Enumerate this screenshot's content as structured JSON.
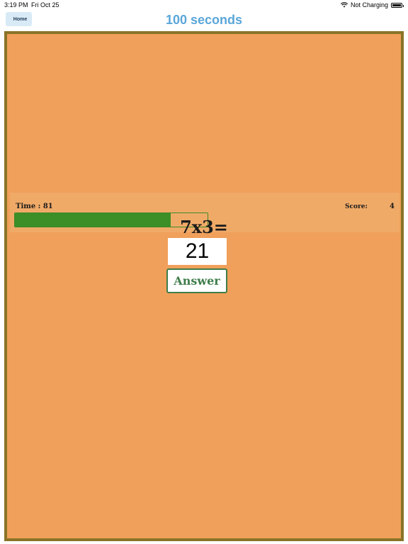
{
  "status_bar": {
    "time": "3:19 PM",
    "date": "Fri Oct 25",
    "charging": "Not Charging",
    "wifi_icon": "wifi-icon",
    "battery_icon": "battery-icon"
  },
  "nav": {
    "home_label": "Home",
    "title": "100 seconds"
  },
  "hud": {
    "time_text": "Time : 81",
    "score_label": "Score:",
    "score_value": "4",
    "progress_fraction": 0.81
  },
  "game": {
    "question": "7x3=",
    "answer_value": "21",
    "answer_button": "Answer"
  },
  "colors": {
    "board_bg": "#f0a05a",
    "board_border": "#8a7428",
    "progress_fill": "#3c8f26",
    "title_color": "#5aa6d8",
    "button_color": "#3f7d4a"
  }
}
